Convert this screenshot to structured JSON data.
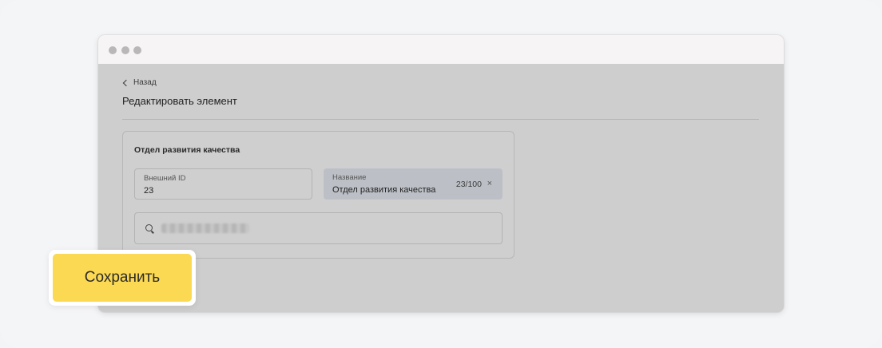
{
  "nav": {
    "back_label": "Назад"
  },
  "page": {
    "title": "Редактировать элемент"
  },
  "card": {
    "title": "Отдел развития качества",
    "external_id": {
      "label": "Внешний ID",
      "value": "23"
    },
    "name": {
      "label": "Название",
      "value": "Отдел развития качества",
      "counter": "23/100",
      "clear_icon": "×"
    },
    "search": {
      "icon": "search-icon"
    }
  },
  "actions": {
    "save_label": "Сохранить"
  },
  "colors": {
    "accent": "#fbd953"
  }
}
